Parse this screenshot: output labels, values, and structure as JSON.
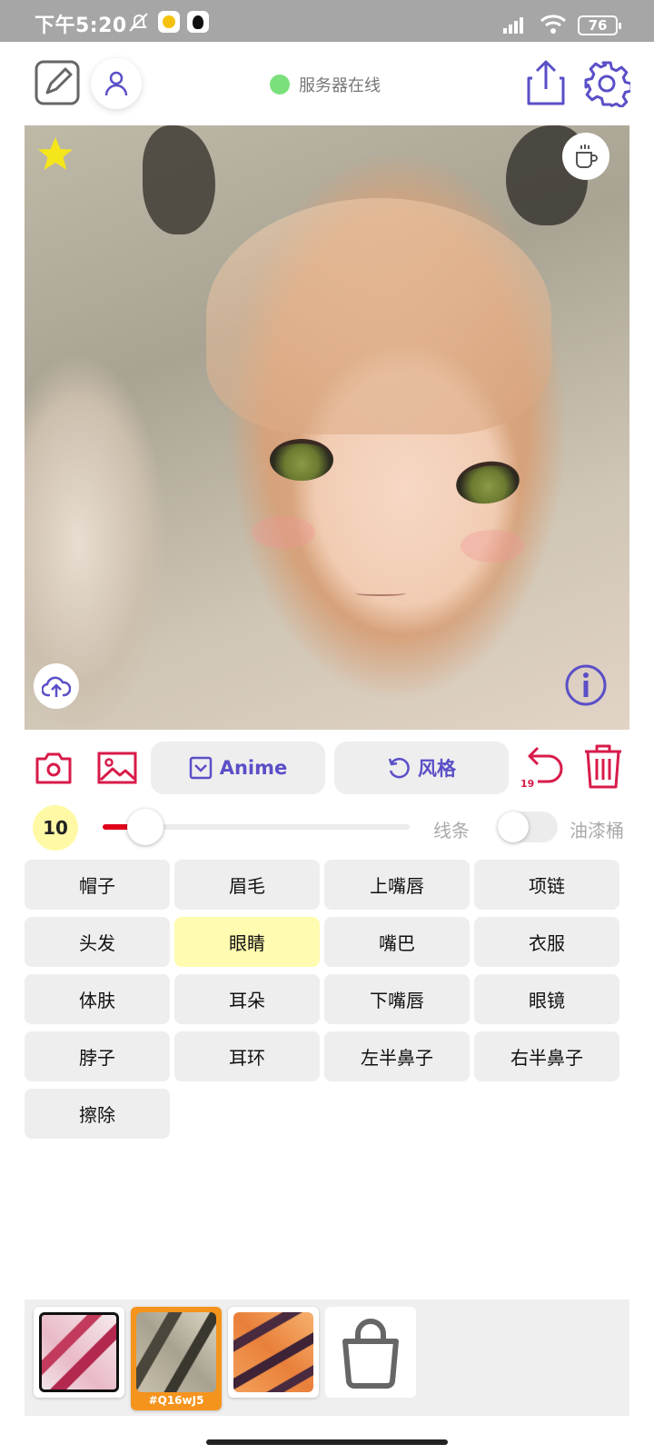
{
  "status_bar": {
    "time": "下午5:20",
    "battery": "76"
  },
  "header": {
    "server_status": "服务器在线",
    "server_color": "#7be07b"
  },
  "toolbar": {
    "anime_label": "Anime",
    "style_label": "风格",
    "undo_count": "19"
  },
  "brush": {
    "size": "10",
    "slider_value_fraction": 0.14,
    "line_label": "线条",
    "bucket_label": "油漆桶",
    "bucket_enabled": false
  },
  "parts": {
    "selected": "眼睛",
    "items": [
      {
        "label": "帽子"
      },
      {
        "label": "眉毛"
      },
      {
        "label": "上嘴唇"
      },
      {
        "label": "项链"
      },
      {
        "label": "头发"
      },
      {
        "label": "眼睛"
      },
      {
        "label": "嘴巴"
      },
      {
        "label": "衣服"
      },
      {
        "label": "体肤"
      },
      {
        "label": "耳朵"
      },
      {
        "label": "下嘴唇"
      },
      {
        "label": "眼镜"
      },
      {
        "label": "脖子"
      },
      {
        "label": "耳环"
      },
      {
        "label": "左半鼻子"
      },
      {
        "label": "右半鼻子"
      },
      {
        "label": "擦除"
      }
    ]
  },
  "tray": {
    "active_tag": "#Q16wJ5"
  },
  "colors": {
    "accent": "#5a4fc7",
    "danger": "#d81b4a",
    "selected_cell": "#fffbb0",
    "active_thumb": "#f5941d"
  }
}
